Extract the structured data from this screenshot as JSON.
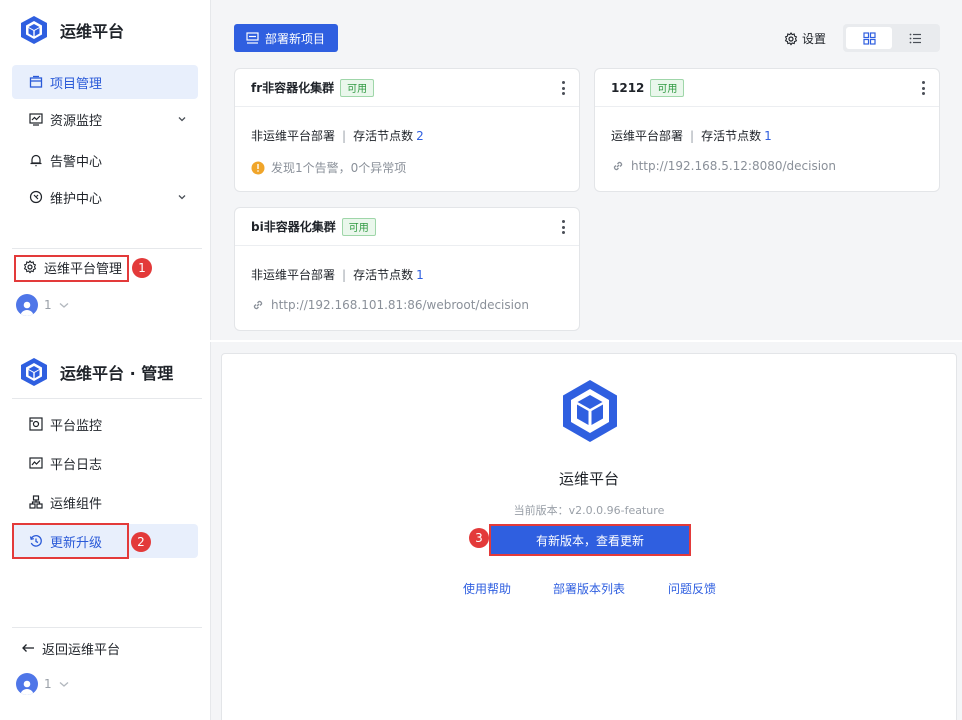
{
  "top": {
    "brand": "运维平台",
    "nav": [
      {
        "label": "项目管理",
        "icon": "project-icon",
        "active": true
      },
      {
        "label": "资源监控",
        "icon": "monitor-icon",
        "expandable": true
      },
      {
        "label": "告警中心",
        "icon": "bell-icon"
      },
      {
        "label": "维护中心",
        "icon": "maintenance-icon",
        "expandable": true
      }
    ],
    "admin_link": "运维平台管理",
    "user": "1",
    "deploy_button": "部署新项目",
    "settings": "设置",
    "cards": [
      {
        "title": "fr非容器化集群",
        "status": "可用",
        "deploy": "非运维平台部署",
        "alive_label": "存活节点数",
        "alive": "2",
        "info": "发现1个告警，0个异常项",
        "info_type": "warning"
      },
      {
        "title": "1212",
        "status": "可用",
        "deploy": "运维平台部署",
        "alive_label": "存活节点数",
        "alive": "1",
        "info": "http://192.168.5.12:8080/decision",
        "info_type": "link"
      },
      {
        "title": "bi非容器化集群",
        "status": "可用",
        "deploy": "非运维平台部署",
        "alive_label": "存活节点数",
        "alive": "1",
        "info": "http://192.168.101.81:86/webroot/decision",
        "info_type": "link"
      }
    ]
  },
  "bottom": {
    "brand": "运维平台 · 管理",
    "nav": [
      {
        "label": "平台监控",
        "icon": "platform-monitor-icon"
      },
      {
        "label": "平台日志",
        "icon": "log-icon"
      },
      {
        "label": "运维组件",
        "icon": "component-icon"
      },
      {
        "label": "更新升级",
        "icon": "upgrade-icon",
        "active": true
      }
    ],
    "back_link": "返回运维平台",
    "user": "1",
    "product": "运维平台",
    "version": "当前版本：v2.0.0.96-feature",
    "update_button": "有新版本，查看更新",
    "links": [
      "使用帮助",
      "部署版本列表",
      "问题反馈"
    ]
  },
  "steps": [
    "1",
    "2",
    "3"
  ],
  "colors": {
    "primary": "#2f5fe0",
    "highlight": "#e33a3a",
    "success": "#2f9a41",
    "warning": "#f0a52a"
  }
}
